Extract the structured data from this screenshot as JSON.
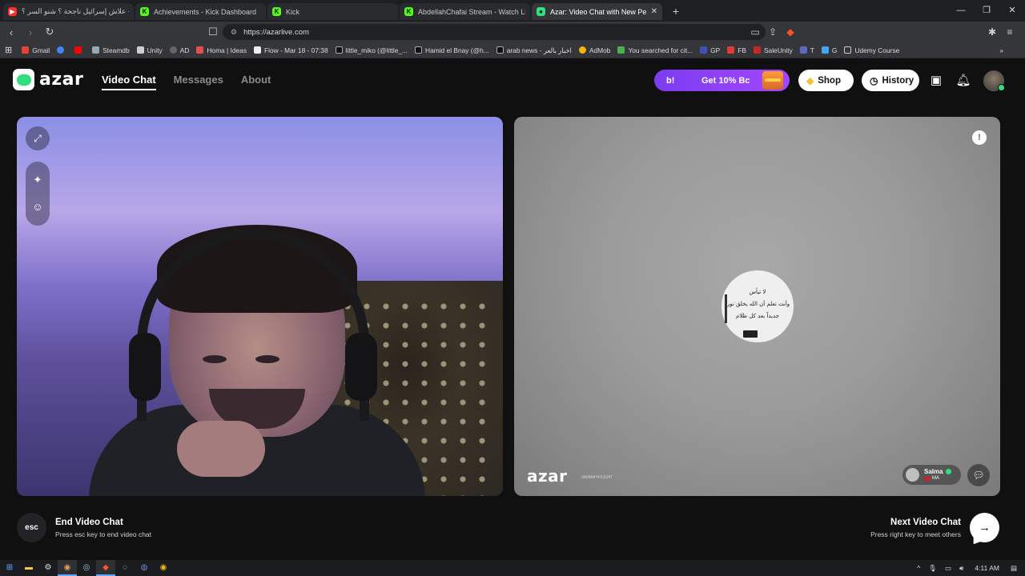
{
  "browser": {
    "tabs": [
      {
        "title": "علاش إسرائيل ناجحة ؟ شنو السر ؟ - be",
        "favicon_color": "#ff2b2b",
        "favicon_glyph": "▶"
      },
      {
        "title": "Achievements - Kick Dashboard",
        "favicon_color": "#53fc18",
        "favicon_glyph": "K"
      },
      {
        "title": "Kick",
        "favicon_color": "#53fc18",
        "favicon_glyph": "K"
      },
      {
        "title": "AbdellahChafai Stream - Watch Liv",
        "favicon_color": "#53fc18",
        "favicon_glyph": "K"
      },
      {
        "title": "Azar: Video Chat with New Pe",
        "favicon_color": "#2fe07d",
        "favicon_glyph": "●",
        "active": true
      }
    ],
    "url": "https://azarlive.com",
    "bookmarks": [
      {
        "label": "Gmail",
        "color": "#ea4335"
      },
      {
        "label": "",
        "color": "#4285f4"
      },
      {
        "label": "",
        "color": "#ff0000"
      },
      {
        "label": "Steamdb",
        "color": "#9aa7b5"
      },
      {
        "label": "Unity",
        "color": "#cfcfcf"
      },
      {
        "label": "AD",
        "color": "#666666"
      },
      {
        "label": "Homa | Ideas",
        "color": "#e84d4d"
      },
      {
        "label": "Flow - Mar 18 - 07:38",
        "color": "#eeeeee"
      },
      {
        "label": "little_miko (@little_...",
        "color": "#111111"
      },
      {
        "label": "Hamid el Bnay (@h...",
        "color": "#111111"
      },
      {
        "label": "arab news - اخبار بالعر",
        "color": "#111111"
      },
      {
        "label": "AdMob",
        "color": "#f4b400"
      },
      {
        "label": "You searched for cit...",
        "color": "#4caf50"
      },
      {
        "label": "GP",
        "color": "#3f51b5"
      },
      {
        "label": "FB",
        "color": "#e53935"
      },
      {
        "label": "SaleUnity",
        "color": "#c62828"
      },
      {
        "label": "T",
        "color": "#5c6bc0"
      },
      {
        "label": "G",
        "color": "#42a5f5"
      },
      {
        "label": "Udemy Course",
        "color": "#888888"
      }
    ]
  },
  "azar": {
    "logo": "azar",
    "nav": {
      "video_chat": "Video Chat",
      "messages": "Messages",
      "about": "About"
    },
    "promo": {
      "badge": "b!",
      "text": "Get 10% Bc"
    },
    "shop": "Shop",
    "history": "History",
    "quote_lines": [
      "لا تيأس",
      "وأنت تعلم أن الله يخلق نوراً",
      "جديداً بعد كل ظلام"
    ],
    "watermark": "azar",
    "watermark_id": "SwMB+PDcRf",
    "peer": {
      "name": "Salma",
      "country": "MA"
    },
    "end_chat": {
      "key": "esc",
      "title": "End Video Chat",
      "subtitle": "Press esc key to end video chat"
    },
    "next_chat": {
      "title": "Next Video Chat",
      "subtitle": "Press right key to meet others"
    }
  },
  "taskbar": {
    "time": "4:11 AM"
  },
  "colors": {
    "accent_green": "#2fe07d",
    "promo_purple": "#8b3cf5"
  }
}
